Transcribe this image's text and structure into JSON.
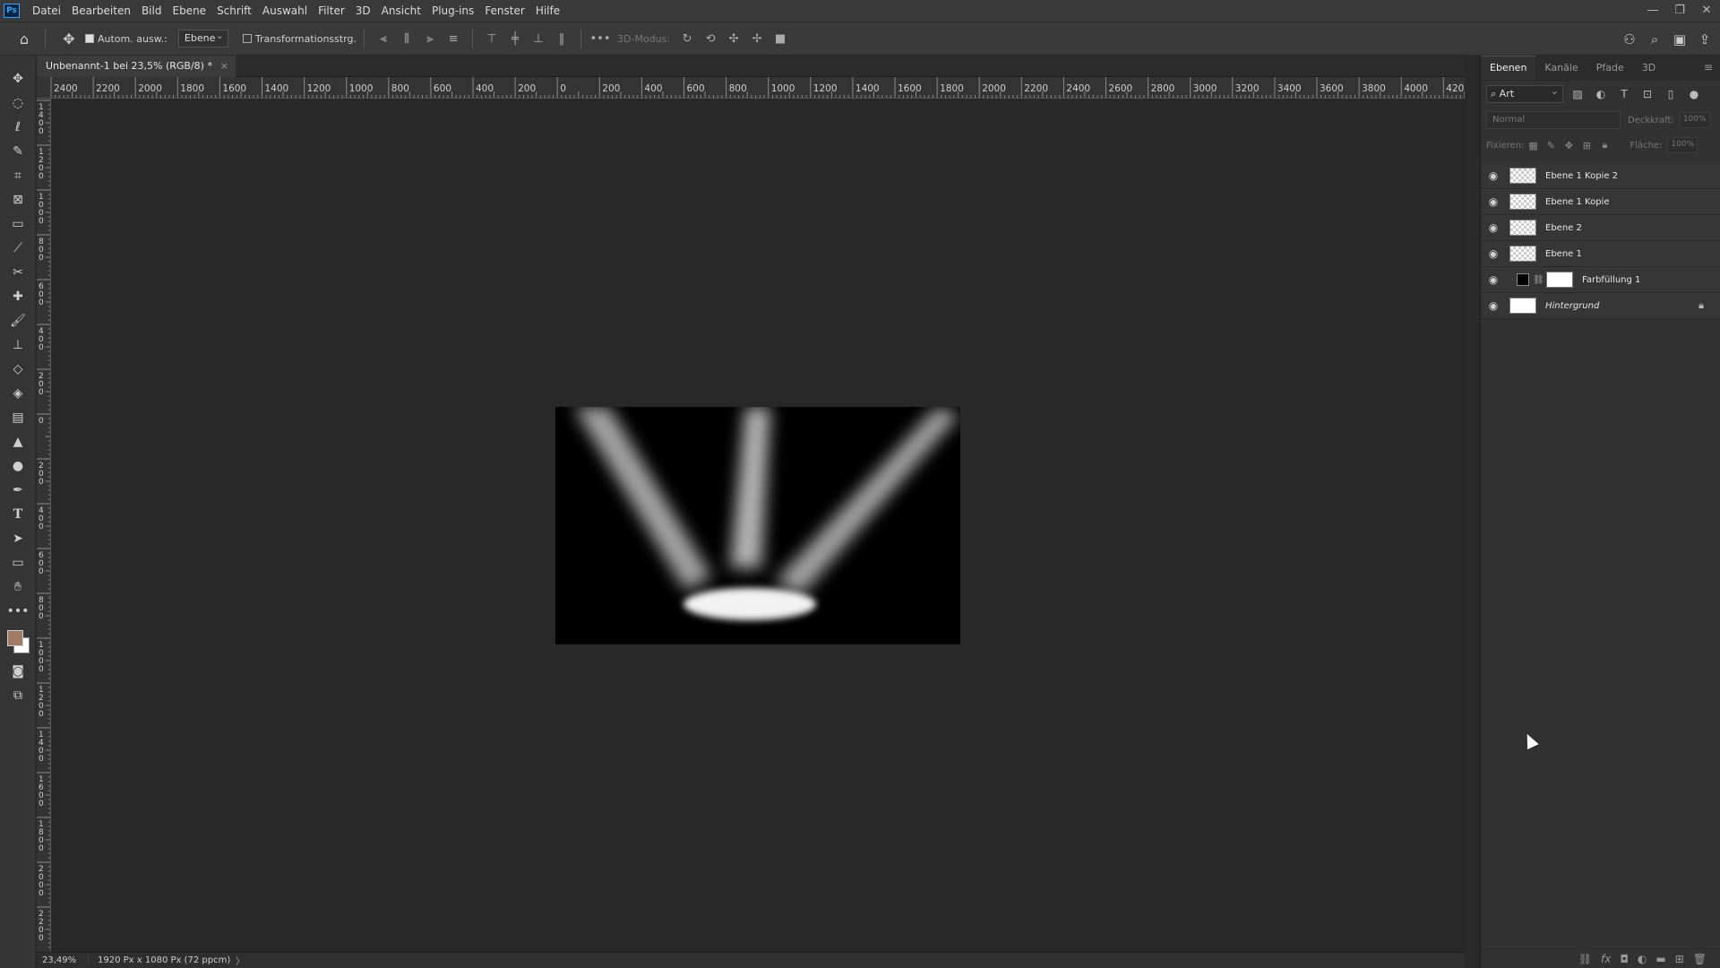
{
  "app": {
    "logo": "Ps"
  },
  "menu": [
    "Datei",
    "Bearbeiten",
    "Bild",
    "Ebene",
    "Schrift",
    "Auswahl",
    "Filter",
    "3D",
    "Ansicht",
    "Plug-ins",
    "Fenster",
    "Hilfe"
  ],
  "window_controls": [
    "—",
    "❐",
    "✕"
  ],
  "options": {
    "auto_select_label": "Autom. ausw.:",
    "auto_select_checked": true,
    "auto_select_target": "Ebene",
    "transform_label": "Transformationsstrg.",
    "transform_checked": false,
    "mode_3d_label": "3D-Modus:",
    "more_label": "•••"
  },
  "document": {
    "tab_title": "Unbenannt-1 bei 23,5% (RGB/8) *",
    "close": "×"
  },
  "ruler": {
    "h_labels": [
      "2400",
      "2200",
      "2000",
      "1800",
      "1600",
      "1400",
      "1200",
      "1000",
      "800",
      "600",
      "400",
      "200",
      "0",
      "200",
      "400",
      "600",
      "800",
      "1000",
      "1200",
      "1400",
      "1600",
      "1800",
      "2000",
      "2200",
      "2400",
      "2600",
      "2800",
      "3000",
      "3200",
      "3400",
      "3600",
      "3800",
      "4000",
      "420"
    ],
    "v_labels": [
      "1400",
      "1200",
      "1000",
      "800",
      "600",
      "400",
      "200",
      "0",
      "200",
      "400",
      "600",
      "800",
      "1000",
      "1200",
      "1400",
      "1600",
      "1800",
      "2000",
      "2200"
    ]
  },
  "status": {
    "zoom": "23,49%",
    "info": "1920 Px x 1080 Px (72 ppcm)",
    "arrow": "〉"
  },
  "layers_panel": {
    "tabs": [
      "Ebenen",
      "Kanäle",
      "Pfade",
      "3D"
    ],
    "active_tab": "Ebenen",
    "filter_kind": "Art",
    "blend_mode": "Normal",
    "opacity_label": "Deckkraft:",
    "opacity_value": "100%",
    "lock_label": "Fixieren:",
    "fill_label": "Fläche:",
    "fill_value": "100%",
    "layers": [
      {
        "name": "Ebene 1 Kopie 2",
        "thumb": "checker"
      },
      {
        "name": "Ebene 1 Kopie",
        "thumb": "checker"
      },
      {
        "name": "Ebene 2",
        "thumb": "checker"
      },
      {
        "name": "Ebene 1",
        "thumb": "checker"
      },
      {
        "name": "Farbfüllung 1",
        "thumb": "fill"
      },
      {
        "name": "Hintergrund",
        "thumb": "white",
        "locked": true
      }
    ]
  },
  "colors": {
    "foreground": "#a07a64",
    "background": "#ffffff",
    "accent": "#31a8ff"
  }
}
